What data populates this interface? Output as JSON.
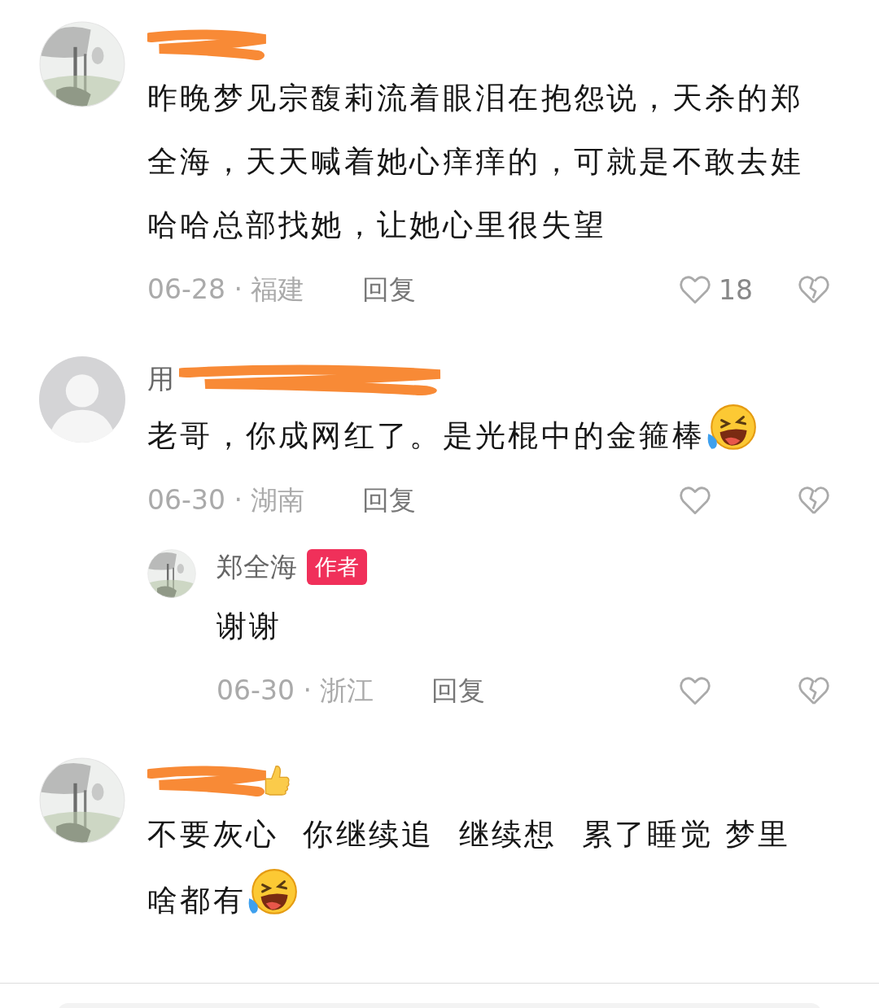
{
  "comments": [
    {
      "name_redacted": true,
      "text": "昨晚梦见宗馥莉流着眼泪在抱怨说，天杀的郑全海，天天喊着她心痒痒的，可就是不敢去娃哈哈总部找她，让她心里很失望",
      "meta": "06-28 · 福建",
      "reply_label": "回复",
      "likes": "18"
    },
    {
      "avatar": {
        "kind": "default"
      },
      "name": "用",
      "name_redacted": true,
      "text": "老哥，你成网红了。是光棍中的金箍棒",
      "emoji_after_text": true,
      "meta": "06-30 · 湖南",
      "reply_label": "回复",
      "replies": [
        {
          "name": "郑全海",
          "badge": "作者",
          "text": "谢谢",
          "meta": "06-30 · 浙江",
          "reply_label": "回复"
        }
      ]
    },
    {
      "name_redacted": true,
      "emoji_after_name": true,
      "text": "不要灰心  你继续追  继续想  累了睡觉 梦里啥都有",
      "emoji_after_text": true
    }
  ]
}
